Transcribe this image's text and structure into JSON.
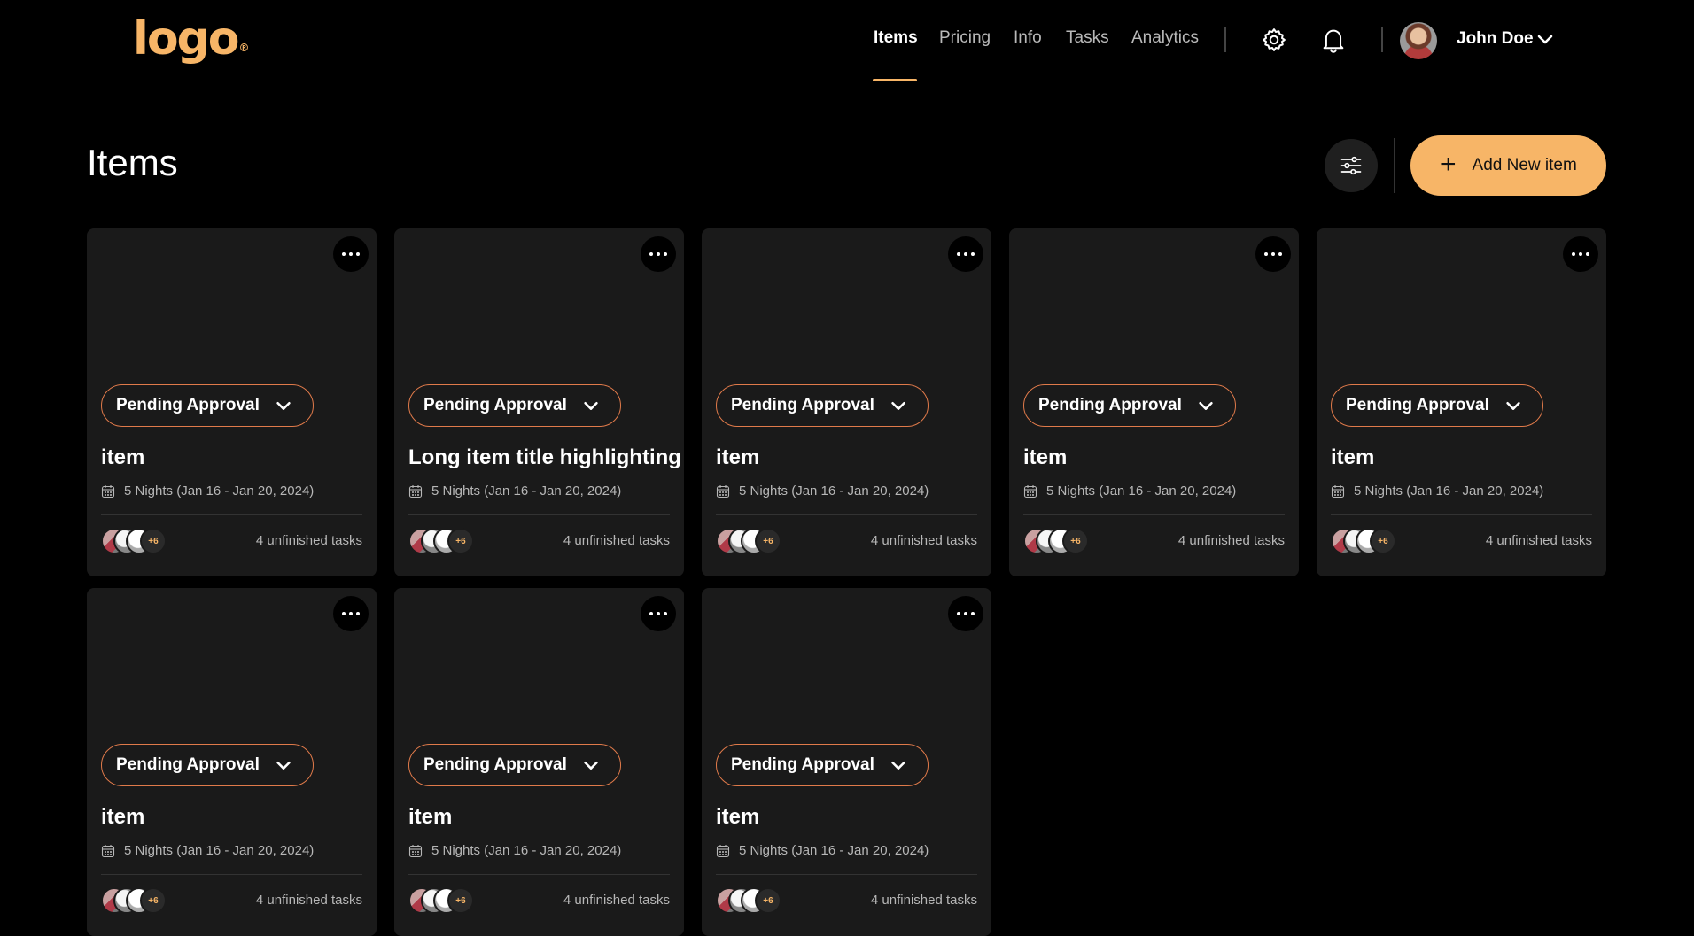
{
  "header": {
    "logo": "logo",
    "nav": [
      {
        "label": "Items",
        "active": true
      },
      {
        "label": "Pricing",
        "active": false
      },
      {
        "label": "Info",
        "active": false
      },
      {
        "label": "Tasks",
        "active": false
      },
      {
        "label": "Analytics",
        "active": false
      }
    ],
    "icons": [
      "settings-icon",
      "bell-icon"
    ],
    "user": {
      "name": "John Doe"
    }
  },
  "page": {
    "title": "Items",
    "filter_icon": "sliders-icon",
    "add_button_label": "Add New item"
  },
  "colors": {
    "accent": "#f7b567",
    "status_border": "#e07a4a",
    "card_bg": "#1a1a1a",
    "page_bg": "#000000"
  },
  "cards": [
    {
      "status": "Pending Approval",
      "title": "item",
      "date": "5 Nights (Jan 16 - Jan 20, 2024)",
      "extra_members": "+6",
      "tasks": "4 unfinished tasks"
    },
    {
      "status": "Pending Approval",
      "title": "Long item title highlighting",
      "date": "5 Nights (Jan 16 - Jan 20, 2024)",
      "extra_members": "+6",
      "tasks": "4 unfinished tasks"
    },
    {
      "status": "Pending Approval",
      "title": "item",
      "date": "5 Nights (Jan 16 - Jan 20, 2024)",
      "extra_members": "+6",
      "tasks": "4 unfinished tasks"
    },
    {
      "status": "Pending Approval",
      "title": "item",
      "date": "5 Nights (Jan 16 - Jan 20, 2024)",
      "extra_members": "+6",
      "tasks": "4 unfinished tasks"
    },
    {
      "status": "Pending Approval",
      "title": "item",
      "date": "5 Nights (Jan 16 - Jan 20, 2024)",
      "extra_members": "+6",
      "tasks": "4 unfinished tasks"
    },
    {
      "status": "Pending Approval",
      "title": "item",
      "date": "5 Nights (Jan 16 - Jan 20, 2024)",
      "extra_members": "+6",
      "tasks": "4 unfinished tasks"
    },
    {
      "status": "Pending Approval",
      "title": "item",
      "date": "5 Nights (Jan 16 - Jan 20, 2024)",
      "extra_members": "+6",
      "tasks": "4 unfinished tasks"
    },
    {
      "status": "Pending Approval",
      "title": "item",
      "date": "5 Nights (Jan 16 - Jan 20, 2024)",
      "extra_members": "+6",
      "tasks": "4 unfinished tasks"
    }
  ]
}
